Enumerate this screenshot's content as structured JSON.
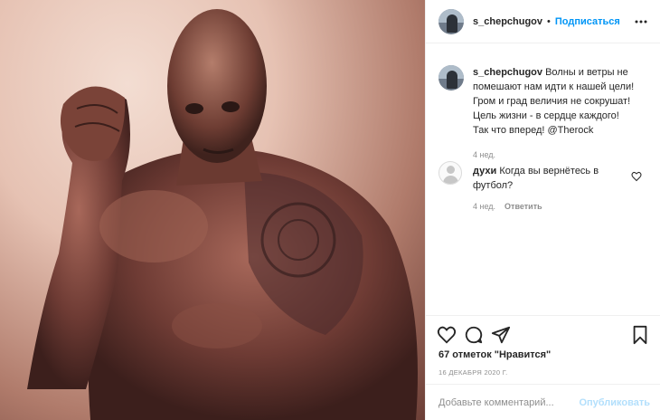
{
  "header": {
    "username": "s_chepchugov",
    "separator": "•",
    "follow_label": "Подписаться",
    "more_icon": "more-options-icon"
  },
  "caption": {
    "username": "s_chepchugov",
    "text": "Волны и ветры не помешают нам идти к нашей цели! Гром и град величия не сокрушат! Цель жизни - в сердце каждого! Так что вперед! @Therock",
    "time": "4 нед."
  },
  "comments": [
    {
      "username": "духи",
      "text": "Когда вы вернётесь в футбол?",
      "time": "4 нед.",
      "reply_label": "Ответить"
    }
  ],
  "actions": {
    "like_icon": "heart-icon",
    "comment_icon": "comment-icon",
    "share_icon": "share-icon",
    "save_icon": "bookmark-icon"
  },
  "likes_label": "67 отметок \"Нравится\"",
  "date": "16 ДЕКАБРЯ 2020 Г.",
  "add_comment": {
    "placeholder": "Добавьте комментарий...",
    "publish_label": "Опубликовать"
  },
  "colors": {
    "accent": "#0095f6",
    "publish_disabled": "#b2dffc",
    "muted": "#8e8e8e",
    "border": "#efefef"
  }
}
